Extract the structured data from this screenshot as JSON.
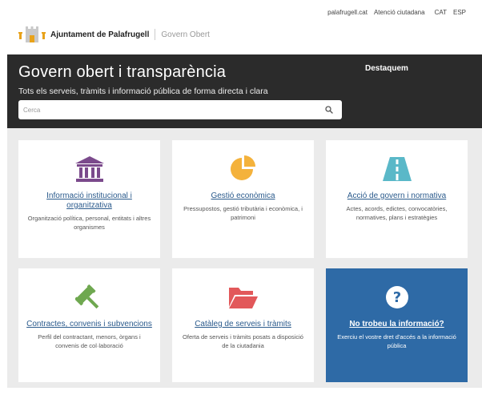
{
  "topnav": {
    "site_link": "palafrugell.cat",
    "citizen_link": "Atenció ciutadana",
    "lang_cat": "CAT",
    "lang_esp": "ESP"
  },
  "brand": {
    "name": "Ajuntament de Palafrugell",
    "subtitle": "Govern Obert"
  },
  "hero": {
    "title": "Govern obert i transparència",
    "tagline": "Tots els serveis, tràmits i informació pública de forma directa i clara",
    "featured_label": "Destaquem",
    "search_placeholder": "Cerca"
  },
  "colors": {
    "hero_bg": "#2b2b2b",
    "link": "#2a5a8c",
    "institution_icon": "#7b4a8c",
    "economy_icon": "#f4b23c",
    "government_icon": "#5ab8c8",
    "contracts_icon": "#6fa850",
    "catalog_icon": "#e2585a",
    "help_card_bg": "#2e6aa6"
  },
  "cards": [
    {
      "icon": "institution-icon",
      "title": "Informació institucional i organitzativa",
      "desc": "Organització política, personal, entitats i altres organismes"
    },
    {
      "icon": "pie-chart-icon",
      "title": "Gestió econòmica",
      "desc": "Pressupostos, gestió tributària i econòmica, i patrimoni"
    },
    {
      "icon": "road-icon",
      "title": "Acció de govern i normativa",
      "desc": "Actes, acords, edictes, convocatòries, normatives, plans i estratègies"
    },
    {
      "icon": "gavel-icon",
      "title": "Contractes, convenis i subvencions",
      "desc": "Perfil del contractant, menors, òrgans i convenis de col·laboració"
    },
    {
      "icon": "folder-open-icon",
      "title": "Catàleg de serveis i tràmits",
      "desc": "Oferta de serveis i tràmits posats a disposició de la ciutadania"
    },
    {
      "icon": "question-icon",
      "title": "No trobeu la informació?",
      "desc": "Exerciu el vostre dret d'accés a la informació pública"
    }
  ]
}
